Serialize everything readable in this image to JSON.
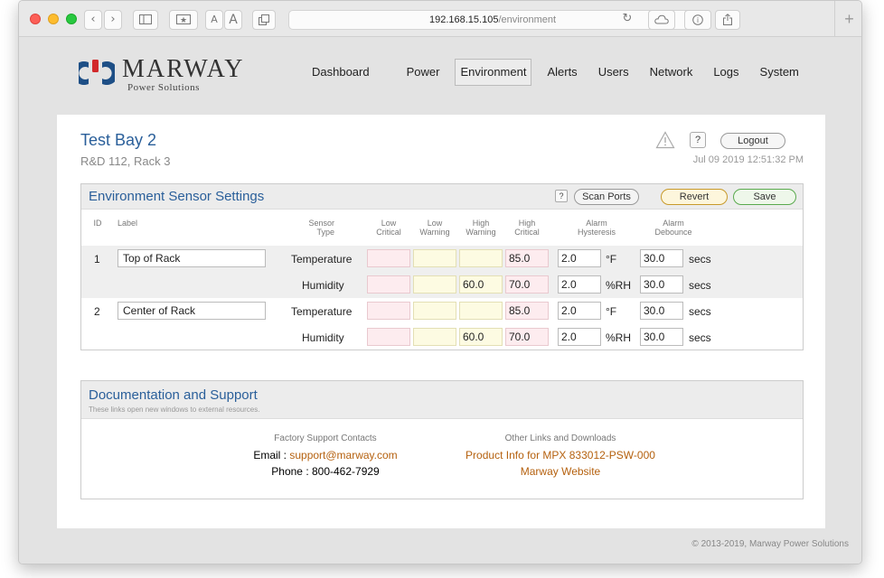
{
  "browser": {
    "url_host": "192.168.15.105",
    "url_path": "/environment",
    "text_btn_small": "A",
    "text_btn_large": "A"
  },
  "brand": {
    "name": "MARWAY",
    "tagline": "Power Solutions"
  },
  "nav": {
    "items": [
      "Dashboard",
      "Power",
      "Environment",
      "Alerts",
      "Users",
      "Network",
      "Logs",
      "System"
    ],
    "active": "Environment"
  },
  "site": {
    "title": "Test Bay 2",
    "subtitle": "R&D 112, Rack 3",
    "help_label": "?",
    "logout_label": "Logout",
    "timestamp": "Jul 09 2019 12:51:32 PM"
  },
  "sensors_panel": {
    "title": "Environment Sensor Settings",
    "help_label": "?",
    "scan_label": "Scan Ports",
    "revert_label": "Revert",
    "save_label": "Save",
    "columns": {
      "id": "ID",
      "label": "Label",
      "sensor_type": [
        "Sensor",
        "Type"
      ],
      "low_critical": [
        "Low",
        "Critical"
      ],
      "low_warning": [
        "Low",
        "Warning"
      ],
      "high_warning": [
        "High",
        "Warning"
      ],
      "high_critical": [
        "High",
        "Critical"
      ],
      "hysteresis": [
        "Alarm",
        "Hysteresis"
      ],
      "debounce": [
        "Alarm",
        "Debounce"
      ]
    },
    "sensors": [
      {
        "id": "1",
        "label": "Top of Rack",
        "rows": [
          {
            "type": "Temperature",
            "low_critical": "",
            "low_warning": "",
            "high_warning": "",
            "high_critical": "85.0",
            "hysteresis": "2.0",
            "unit": "°F",
            "debounce": "30.0",
            "debounce_unit": "secs"
          },
          {
            "type": "Humidity",
            "low_critical": "",
            "low_warning": "",
            "high_warning": "60.0",
            "high_critical": "70.0",
            "hysteresis": "2.0",
            "unit": "%RH",
            "debounce": "30.0",
            "debounce_unit": "secs"
          }
        ]
      },
      {
        "id": "2",
        "label": "Center of Rack",
        "rows": [
          {
            "type": "Temperature",
            "low_critical": "",
            "low_warning": "",
            "high_warning": "",
            "high_critical": "85.0",
            "hysteresis": "2.0",
            "unit": "°F",
            "debounce": "30.0",
            "debounce_unit": "secs"
          },
          {
            "type": "Humidity",
            "low_critical": "",
            "low_warning": "",
            "high_warning": "60.0",
            "high_critical": "70.0",
            "hysteresis": "2.0",
            "unit": "%RH",
            "debounce": "30.0",
            "debounce_unit": "secs"
          }
        ]
      }
    ]
  },
  "docs_panel": {
    "title": "Documentation and Support",
    "description": "These links open new windows to external resources.",
    "support": {
      "header": "Factory Support Contacts",
      "email_label": "Email : ",
      "email": "support@marway.com",
      "phone": "Phone : 800-462-7929"
    },
    "links": {
      "header": "Other Links and Downloads",
      "product_info": "Product Info for MPX 833012-PSW-000",
      "website": "Marway Website"
    }
  },
  "footer": {
    "copyright": "© 2013-2019, Marway Power Solutions"
  },
  "colors": {
    "accent": "#2a5f9a",
    "link": "#b5610f",
    "critical_fill": "#fdecef",
    "warning_fill": "#fdfbe2"
  }
}
